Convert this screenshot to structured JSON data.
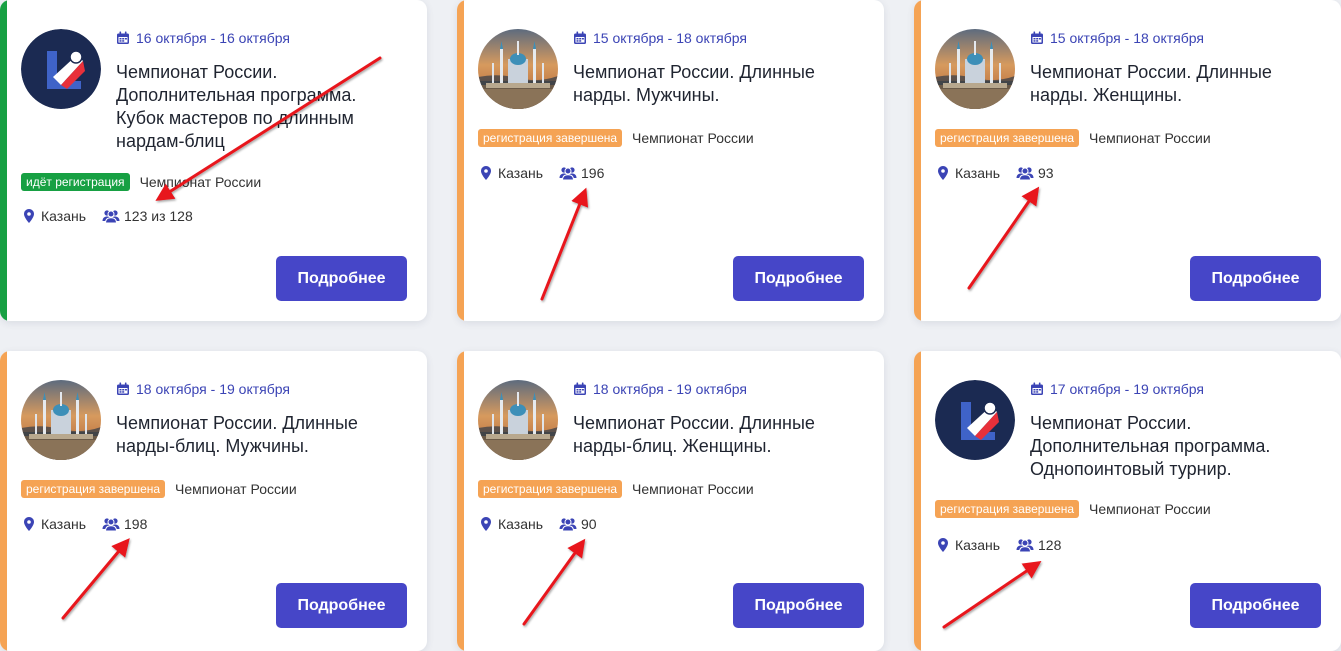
{
  "button_label": "Подробнее",
  "colors": {
    "accent": "#4646c8",
    "date": "#3b44b5",
    "status_open": "#17a043",
    "status_closed": "#f5a354"
  },
  "cards": [
    {
      "date": "16 октября - 16 октября",
      "title": "Чемпионат России. Дополнительная программа. Кубок мастеров по длинным нардам-блиц",
      "status": "идёт регистрация",
      "status_type": "open",
      "category": "Чемпионат России",
      "city": "Казань",
      "participants": "123 из 128",
      "image": "logo"
    },
    {
      "date": "15 октября - 18 октября",
      "title": "Чемпионат России. Длинные нарды. Мужчины.",
      "status": "регистрация завершена",
      "status_type": "closed",
      "category": "Чемпионат России",
      "city": "Казань",
      "participants": "196",
      "image": "kazan-photo"
    },
    {
      "date": "15 октября - 18 октября",
      "title": "Чемпионат России. Длинные нарды. Женщины.",
      "status": "регистрация завершена",
      "status_type": "closed",
      "category": "Чемпионат России",
      "city": "Казань",
      "participants": "93",
      "image": "kazan-photo"
    },
    {
      "date": "18 октября - 19 октября",
      "title": "Чемпионат России. Длинные нарды-блиц. Мужчины.",
      "status": "регистрация завершена",
      "status_type": "closed",
      "category": "Чемпионат России",
      "city": "Казань",
      "participants": "198",
      "image": "kazan-photo"
    },
    {
      "date": "18 октября - 19 октября",
      "title": "Чемпионат России. Длинные нарды-блиц. Женщины.",
      "status": "регистрация завершена",
      "status_type": "closed",
      "category": "Чемпионат России",
      "city": "Казань",
      "participants": "90",
      "image": "kazan-photo"
    },
    {
      "date": "17 октября - 19 октября",
      "title": "Чемпионат России. Дополнительная программа. Однопоинтовый турнир.",
      "status": "регистрация завершена",
      "status_type": "closed",
      "category": "Чемпионат России",
      "city": "Казань",
      "participants": "128",
      "image": "logo"
    }
  ]
}
